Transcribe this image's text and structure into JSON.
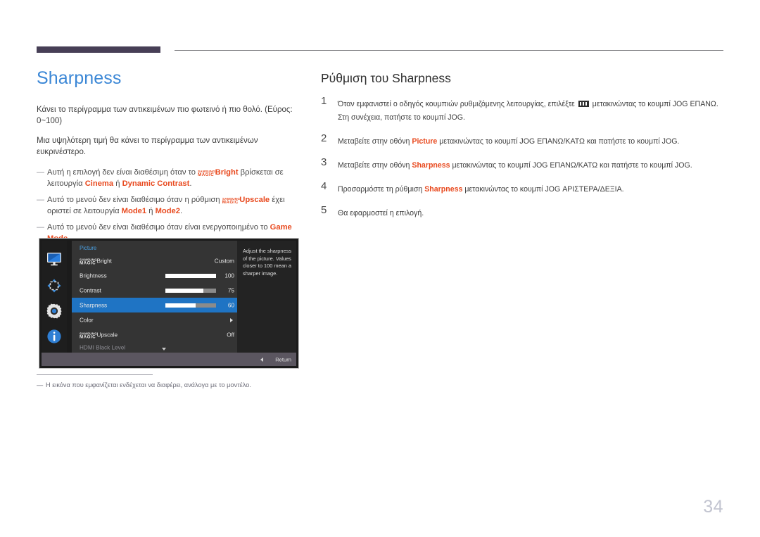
{
  "header": {
    "rule_color": "#473f56",
    "thin_rule_color": "#6f6f72"
  },
  "left": {
    "title": "Sharpness",
    "title_color": "#3b87d6",
    "paragraphs": [
      "Κάνει το περίγραμμα των αντικειμένων πιο φωτεινό ή πιο θολό. (Εύρος: 0~100)",
      "Μια υψηλότερη τιμή θα κάνει το περίγραμμα των αντικειμένων ευκρινέστερο."
    ],
    "notes": [
      {
        "dash": "―",
        "seg1": "Αυτή η επιλογή δεν είναι διαθέσιμη όταν το ",
        "logo_top": "SAMSUNG",
        "logo_bottom": "MAGIC",
        "hl1": "Bright",
        "seg2": " βρίσκεται σε λειτουργία ",
        "hl2": "Cinema",
        "seg3": " ή ",
        "hl3": "Dynamic Contrast",
        "seg4": "."
      },
      {
        "dash": "―",
        "seg1": "Αυτό το μενού δεν είναι διαθέσιμο όταν η ρύθμιση ",
        "logo_top": "SAMSUNG",
        "logo_bottom": "MAGIC",
        "hl1": "Upscale",
        "seg2": " έχει οριστεί σε λειτουργία ",
        "hl2": "Mode1",
        "seg3": " ή ",
        "hl3": "Mode2",
        "seg4": "."
      },
      {
        "dash": "―",
        "seg1": "Αυτό το μενού δεν είναι διαθέσιμο όταν είναι ενεργοποιημένο το ",
        "hl1": "Game Mode",
        "seg2": "."
      }
    ],
    "highlight_color": "#e8491e"
  },
  "osd": {
    "header_label": "Picture",
    "header_color": "#4a9fe0",
    "selected_color": "#1f74c4",
    "icons": [
      {
        "name": "monitor-icon",
        "label": "Picture"
      },
      {
        "name": "onscreen-display-icon",
        "label": "OnScreen Display"
      },
      {
        "name": "gear-icon",
        "label": "System"
      },
      {
        "name": "info-icon",
        "label": "Information"
      }
    ],
    "rows": [
      {
        "logo_top": "SAMSUNG",
        "logo_bottom": "MAGIC",
        "label": "Bright",
        "value": "Custom",
        "type": "value",
        "selected": false,
        "dim": false
      },
      {
        "label": "Brightness",
        "value": "100",
        "type": "slider",
        "percent": 100,
        "selected": false,
        "dim": false
      },
      {
        "label": "Contrast",
        "value": "75",
        "type": "slider",
        "percent": 75,
        "selected": false,
        "dim": false
      },
      {
        "label": "Sharpness",
        "value": "60",
        "type": "slider",
        "percent": 60,
        "selected": true,
        "dim": false
      },
      {
        "label": "Color",
        "value": "",
        "type": "submenu",
        "selected": false,
        "dim": false
      },
      {
        "logo_top": "SAMSUNG",
        "logo_bottom": "MAGIC",
        "label": "Upscale",
        "value": "Off",
        "type": "value",
        "selected": false,
        "dim": false
      },
      {
        "label": "HDMI Black Level",
        "value": "",
        "type": "value",
        "selected": false,
        "dim": true
      }
    ],
    "description": "Adjust the sharpness of the picture. Values closer to 100 mean a sharper image.",
    "return_label": "Return"
  },
  "footnote": {
    "dash": "―",
    "text": "Η εικόνα που εμφανίζεται ενδέχεται να διαφέρει, ανάλογα με το μοντέλο."
  },
  "right": {
    "section_title": "Ρύθμιση του Sharpness",
    "steps": [
      {
        "num": "1",
        "seg1": "Όταν εμφανιστεί ο οδηγός κουμπιών ρυθμιζόμενης λειτουργίας, επιλέξτε ",
        "has_jog_icon": true,
        "seg2": " μετακινώντας το κουμπί JOG ΕΠΑΝΩ. Στη συνέχεια, πατήστε το κουμπί JOG."
      },
      {
        "num": "2",
        "seg1": "Μεταβείτε στην οθόνη ",
        "hl": "Picture",
        "seg2": " μετακινώντας το κουμπί JOG ΕΠΑΝΩ/ΚΑΤΩ και πατήστε το κουμπί JOG."
      },
      {
        "num": "3",
        "seg1": "Μεταβείτε στην οθόνη ",
        "hl": "Sharpness",
        "seg2": " μετακινώντας το κουμπί JOG ΕΠΑΝΩ/ΚΑΤΩ και πατήστε το κουμπί JOG."
      },
      {
        "num": "4",
        "seg1": "Προσαρμόστε τη ρύθμιση ",
        "hl": "Sharpness",
        "seg2": " μετακινώντας το κουμπί JOG ΑΡΙΣΤΕΡΑ/ΔΕΞΙΑ."
      },
      {
        "num": "5",
        "seg1": "Θα εφαρμοστεί η επιλογή.",
        "hl": "",
        "seg2": ""
      }
    ]
  },
  "page_number": "34"
}
